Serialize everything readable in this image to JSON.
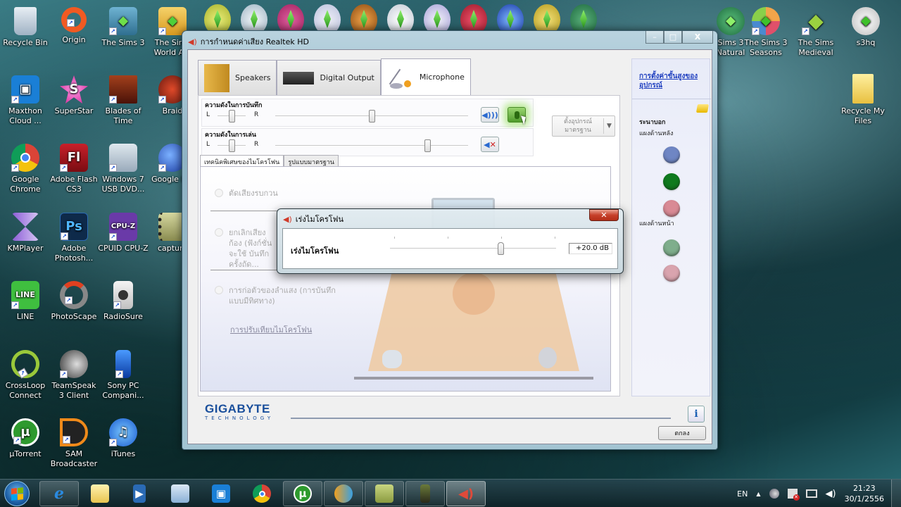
{
  "desktop": {
    "icons": [
      {
        "label": "Recycle Bin",
        "icon": "recycle-bin-icon"
      },
      {
        "label": "Origin",
        "icon": "origin-icon"
      },
      {
        "label": "The Sims 3",
        "icon": "sims3-icon"
      },
      {
        "label": "The Sims World A...",
        "icon": "sims3-world-icon"
      },
      {
        "label": "Maxthon Cloud ...",
        "icon": "maxthon-icon"
      },
      {
        "label": "SuperStar",
        "icon": "superstar-icon"
      },
      {
        "label": "Blades of Time",
        "icon": "blades-of-time-icon"
      },
      {
        "label": "Braid",
        "icon": "braid-icon"
      },
      {
        "label": "Google Chrome",
        "icon": "chrome-icon"
      },
      {
        "label": "Adobe Flash CS3",
        "icon": "flash-icon"
      },
      {
        "label": "Windows 7 USB DVD...",
        "icon": "win7-usb-icon"
      },
      {
        "label": "Google E...",
        "icon": "google-earth-icon"
      },
      {
        "label": "KMPlayer",
        "icon": "kmplayer-icon"
      },
      {
        "label": "Adobe Photosh...",
        "icon": "photoshop-icon"
      },
      {
        "label": "CPUID CPU-Z",
        "icon": "cpuz-icon"
      },
      {
        "label": "capture",
        "icon": "capture-icon"
      },
      {
        "label": "LINE",
        "icon": "line-icon"
      },
      {
        "label": "PhotoScape",
        "icon": "photoscape-icon"
      },
      {
        "label": "RadioSure",
        "icon": "radiosure-icon"
      },
      {
        "label": "CrossLoop Connect",
        "icon": "crossloop-icon"
      },
      {
        "label": "TeamSpeak 3 Client",
        "icon": "teamspeak-icon"
      },
      {
        "label": "Sony PC Compani...",
        "icon": "sony-pc-companion-icon"
      },
      {
        "label": "µTorrent",
        "icon": "utorrent-icon"
      },
      {
        "label": "SAM Broadcaster",
        "icon": "sam-broadcaster-icon"
      },
      {
        "label": "iTunes",
        "icon": "itunes-icon"
      },
      {
        "label": "Sims 3 Natural",
        "icon": "sims3-supernatural-icon"
      },
      {
        "label": "The Sims 3 Seasons",
        "icon": "sims3-seasons-icon"
      },
      {
        "label": "The Sims Medieval",
        "icon": "sims-medieval-icon"
      },
      {
        "label": "s3hq",
        "icon": "s3hq-icon"
      },
      {
        "label": "Recycle My Files",
        "icon": "folder-icon"
      }
    ]
  },
  "realtek": {
    "title": "การกำหนดค่าเสียง Realtek HD",
    "controls": {
      "minimize": "–",
      "maximize": "□",
      "close": "X"
    },
    "device_tabs": [
      {
        "label": "Speakers",
        "active": false
      },
      {
        "label": "Digital Output",
        "active": false
      },
      {
        "label": "Microphone",
        "active": true
      }
    ],
    "recording_volume": {
      "label": "ความดังในการบันทึก",
      "left": "L",
      "right": "R",
      "balance": 0.5,
      "level": 0.5
    },
    "playback_volume": {
      "label": "ความดังในการเล่น",
      "left": "L",
      "right": "R",
      "balance": 0.5,
      "level": 0.79
    },
    "default_device": "ตั้งอุปกรณ์มาตรฐาน",
    "effects_tabs": [
      "เทคนิคพิเศษของไมโครโฟน",
      "รูปแบบมาตรฐาน"
    ],
    "effects": [
      {
        "label": "ตัดเสียงรบกวน"
      },
      {
        "label": "ยกเลิกเสียงก้อง (ฟังก์ชั่นจะใช้ บันทึกครั้งถัด..."
      },
      {
        "label": "การก่อตัวของลำแสง (การบันทึกแบบมีทิศทาง)"
      }
    ],
    "calibrate_link": "การปรับเทียบไมโครโฟน",
    "side": {
      "advanced_link": "การตั้งค่าขั้นสูงของอุปกรณ์",
      "analog_label": "ระนาบอก",
      "rear_panel": "แผงด้านหลัง",
      "front_panel": "แผงด้านหน้า",
      "rear_jacks": [
        "#6f86c4",
        "#0f7a1e",
        "#d98a95"
      ],
      "front_jacks": [
        "#7fae8c",
        "#d9a4ae"
      ]
    },
    "brand": {
      "name": "GIGABYTE",
      "sub": "TECHNOLOGY"
    },
    "info_label": "i",
    "ok_label": "ตกลง"
  },
  "mic_boost_dialog": {
    "title": "เร่งไมโครโฟน",
    "label": "เร่งไมโครโฟน",
    "value": "+20.0 dB",
    "level": 0.667,
    "close": "✕"
  },
  "taskbar": {
    "items": [
      {
        "name": "internet-explorer",
        "state": "open"
      },
      {
        "name": "windows-explorer",
        "state": "pinned"
      },
      {
        "name": "media-player",
        "state": "pinned"
      },
      {
        "name": "control-panel",
        "state": "pinned"
      },
      {
        "name": "maxthon",
        "state": "pinned"
      },
      {
        "name": "chrome",
        "state": "pinned"
      },
      {
        "name": "utorrent",
        "state": "open"
      },
      {
        "name": "messenger",
        "state": "open"
      },
      {
        "name": "notes",
        "state": "open"
      },
      {
        "name": "camtasia",
        "state": "open"
      },
      {
        "name": "realtek-audio",
        "state": "active"
      }
    ],
    "tray": {
      "language": "EN",
      "time": "21:23",
      "date": "30/1/2556"
    }
  }
}
